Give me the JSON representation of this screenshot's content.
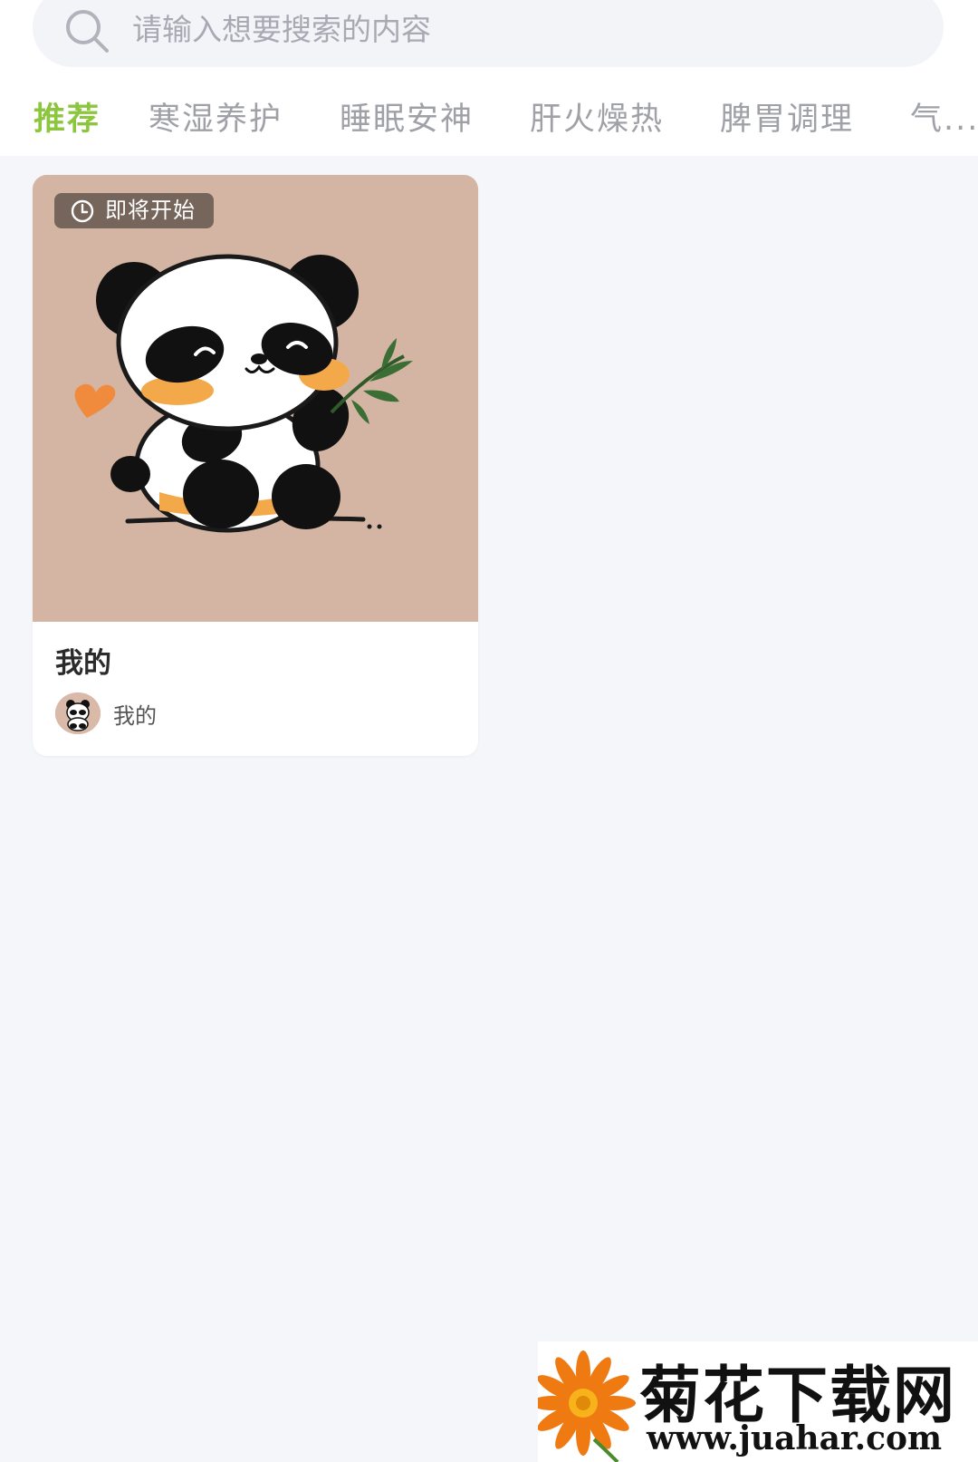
{
  "search": {
    "placeholder": "请输入想要搜索的内容",
    "icon": "search-icon"
  },
  "tabs": [
    {
      "label": "推荐",
      "active": true
    },
    {
      "label": "寒湿养护",
      "active": false
    },
    {
      "label": "睡眠安神",
      "active": false
    },
    {
      "label": "肝火燥热",
      "active": false
    },
    {
      "label": "脾胃调理",
      "active": false
    },
    {
      "label": "气...",
      "active": false
    }
  ],
  "colors": {
    "accent": "#8cc63f",
    "tab_inactive": "#9fa1a7",
    "page_bg": "#f4f6fa",
    "cover_bg": "#d4b5a3"
  },
  "card": {
    "badge": "即将开始",
    "badge_icon": "clock-icon",
    "title": "我的",
    "author": "我的",
    "cover_image": "panda-illustration"
  },
  "watermark": {
    "brand": "菊花下载网",
    "url": "www.juahar.com"
  }
}
